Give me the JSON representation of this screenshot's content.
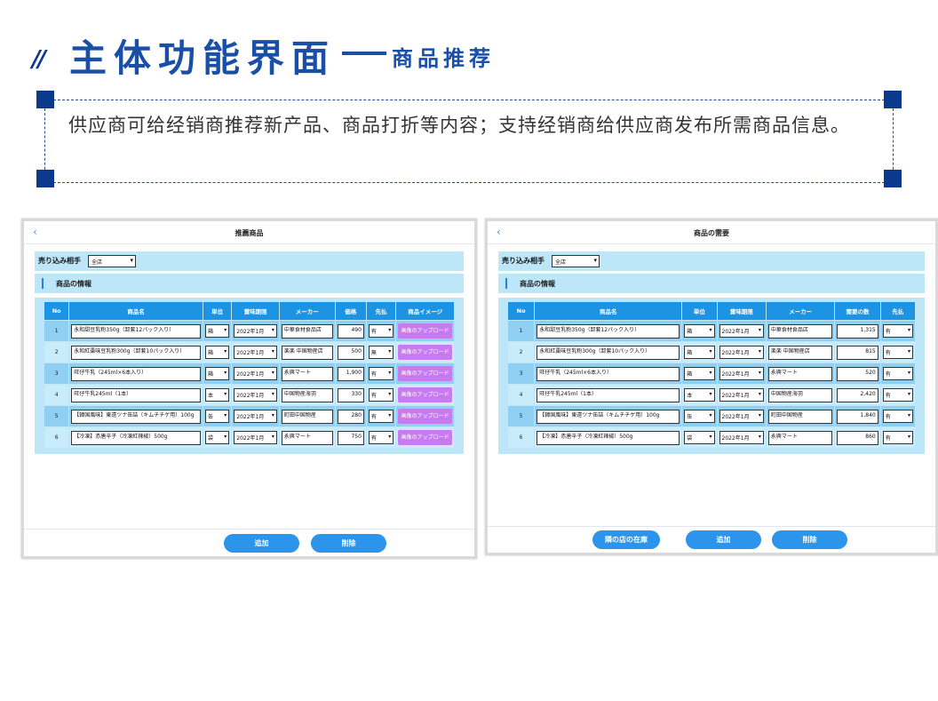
{
  "header": {
    "slashes": "//",
    "title": "主体功能界面",
    "subtitle": "商品推荐"
  },
  "description": "供应商可给经销商推荐新产品、商品打折等内容；支持经销商给供应商发布所需商品信息。",
  "left_screen": {
    "title": "推薦商品",
    "back_icon": "‹",
    "filter_label": "売り込み相手",
    "filter_value": "全店",
    "section_label": "商品の情報",
    "columns": [
      "No",
      "商品名",
      "単位",
      "賞味期限",
      "メーカー",
      "価格",
      "先払",
      "商品イメージ"
    ],
    "rows": [
      {
        "no": "1",
        "name": "永和甜豆乳粉350g（卸套12パック入り）",
        "unit": "箱",
        "expiry": "2022年1月",
        "maker": "中華食材食品店",
        "price": "490",
        "prepay": "有",
        "image": "画像のアップロード"
      },
      {
        "no": "2",
        "name": "永和紅棗味豆乳粉300g（卸套10パック入り）",
        "unit": "箱",
        "expiry": "2022年1月",
        "maker": "楽楽 中国物産店",
        "price": "500",
        "prepay": "無",
        "image": "画像のアップロード"
      },
      {
        "no": "3",
        "name": "旺仔牛乳（245ml×6本入り）",
        "unit": "箱",
        "expiry": "2022年1月",
        "maker": "永興マート",
        "price": "1,900",
        "prepay": "有",
        "image": "画像のアップロード"
      },
      {
        "no": "4",
        "name": "旺仔牛乳245ml（1本）",
        "unit": "本",
        "expiry": "2022年1月",
        "maker": "中国物産海羽",
        "price": "330",
        "prepay": "有",
        "image": "画像のアップロード"
      },
      {
        "no": "5",
        "name": "【韓国風味】東遠ツナ缶詰（キムチチゲ用）100g",
        "unit": "缶",
        "expiry": "2022年1月",
        "maker": "町田中国物産",
        "price": "280",
        "prepay": "有",
        "image": "画像のアップロード"
      },
      {
        "no": "6",
        "name": "【冷凍】赤唐辛子（冷凍紅辣椒）500g",
        "unit": "袋",
        "expiry": "2022年1月",
        "maker": "永興マート",
        "price": "750",
        "prepay": "有",
        "image": "画像のアップロード"
      }
    ],
    "buttons": {
      "add": "追加",
      "delete": "削除"
    }
  },
  "right_screen": {
    "title": "商品の需要",
    "back_icon": "‹",
    "filter_label": "売り込み相手",
    "filter_value": "全店",
    "section_label": "商品の情報",
    "columns": [
      "No",
      "商品名",
      "単位",
      "賞味期限",
      "メーカー",
      "需要の数",
      "先払"
    ],
    "rows": [
      {
        "no": "1",
        "name": "永和甜豆乳粉350g（卸套12パック入り）",
        "unit": "箱",
        "expiry": "2022年1月",
        "maker": "中華食材食品店",
        "qty": "1,315",
        "prepay": "有"
      },
      {
        "no": "2",
        "name": "永和紅棗味豆乳粉300g（卸套10パック入り）",
        "unit": "箱",
        "expiry": "2022年1月",
        "maker": "楽楽 中国物産店",
        "qty": "815",
        "prepay": "有"
      },
      {
        "no": "3",
        "name": "旺仔牛乳（245ml×6本入り）",
        "unit": "箱",
        "expiry": "2022年1月",
        "maker": "永興マート",
        "qty": "520",
        "prepay": "有"
      },
      {
        "no": "4",
        "name": "旺仔牛乳245ml（1本）",
        "unit": "本",
        "expiry": "2022年1月",
        "maker": "中国物産海羽",
        "qty": "2,420",
        "prepay": "有"
      },
      {
        "no": "5",
        "name": "【韓国風味】東遠ツナ缶詰（キムチチゲ用）100g",
        "unit": "缶",
        "expiry": "2022年1月",
        "maker": "町田中国物産",
        "qty": "1,840",
        "prepay": "有"
      },
      {
        "no": "6",
        "name": "【冷凍】赤唐辛子（冷凍紅辣椒）500g",
        "unit": "袋",
        "expiry": "2022年1月",
        "maker": "永興マート",
        "qty": "860",
        "prepay": "有"
      }
    ],
    "buttons": {
      "stock": "隣の店の在庫",
      "add": "追加",
      "delete": "削除"
    }
  },
  "colors": {
    "brand_blue": "#1a4fa8",
    "corner_blue": "#0b3a8c",
    "table_header": "#1c93e3",
    "row_odd": "#8fd0f2",
    "row_even": "#c9ecfb",
    "button_blue": "#2c94ea",
    "image_button": "#c77bee"
  },
  "icons": {
    "back": "chevron-left-icon",
    "dropdown": "chevron-down-icon"
  }
}
